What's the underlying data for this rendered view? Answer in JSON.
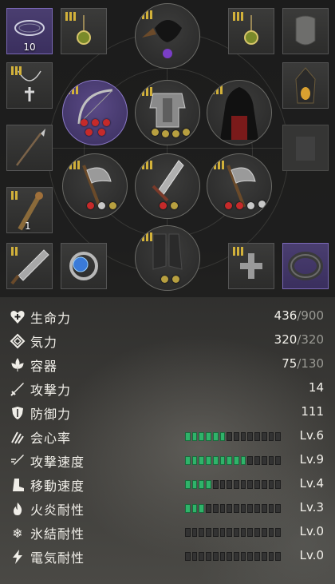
{
  "equipment": {
    "consumable_count": "10",
    "torch_count": "1",
    "slot_names": [
      "ring-slot-top-left",
      "amulet-slot-top",
      "helmet-slot",
      "amulet-slot-top-right",
      "mask-slot",
      "necklace-slot",
      "bow-slot",
      "armor-slot",
      "cloak-slot",
      "lantern-slot",
      "spear-slot",
      "empty-slot-left",
      "empty-slot-right",
      "torch-slot",
      "axe-slot-left",
      "sword-slot",
      "axe-slot-right",
      "knife-slot",
      "ring-slot-blue",
      "boots-slot",
      "relic-slot",
      "bracelet-slot"
    ]
  },
  "stats": {
    "hp": {
      "label": "生命力",
      "current": "436",
      "max": "/900",
      "icon": "heart-plus-icon"
    },
    "spirit": {
      "label": "気力",
      "current": "320",
      "max": "/320",
      "icon": "spiral-icon"
    },
    "vessel": {
      "label": "容器",
      "current": "75",
      "max": "/130",
      "icon": "leaf-icon"
    },
    "attack": {
      "label": "攻撃力",
      "value": "14",
      "icon": "sword-icon"
    },
    "defense": {
      "label": "防御力",
      "value": "111",
      "icon": "shield-icon"
    },
    "crit": {
      "label": "会心率",
      "level": "Lv.6",
      "filled": 6,
      "icon": "claw-icon"
    },
    "attack_speed": {
      "label": "攻撃速度",
      "level": "Lv.9",
      "filled": 9,
      "icon": "swift-sword-icon"
    },
    "move_speed": {
      "label": "移動速度",
      "level": "Lv.4",
      "filled": 4,
      "icon": "boot-icon"
    },
    "fire_res": {
      "label": "火炎耐性",
      "level": "Lv.3",
      "filled": 3,
      "icon": "flame-icon"
    },
    "ice_res": {
      "label": "氷結耐性",
      "level": "Lv.0",
      "filled": 0,
      "icon": "snowflake-icon"
    },
    "elec_res": {
      "label": "電気耐性",
      "level": "Lv.0",
      "filled": 0,
      "icon": "lightning-icon"
    },
    "bar_segments": 14,
    "accent_color": "#2fb36a"
  }
}
